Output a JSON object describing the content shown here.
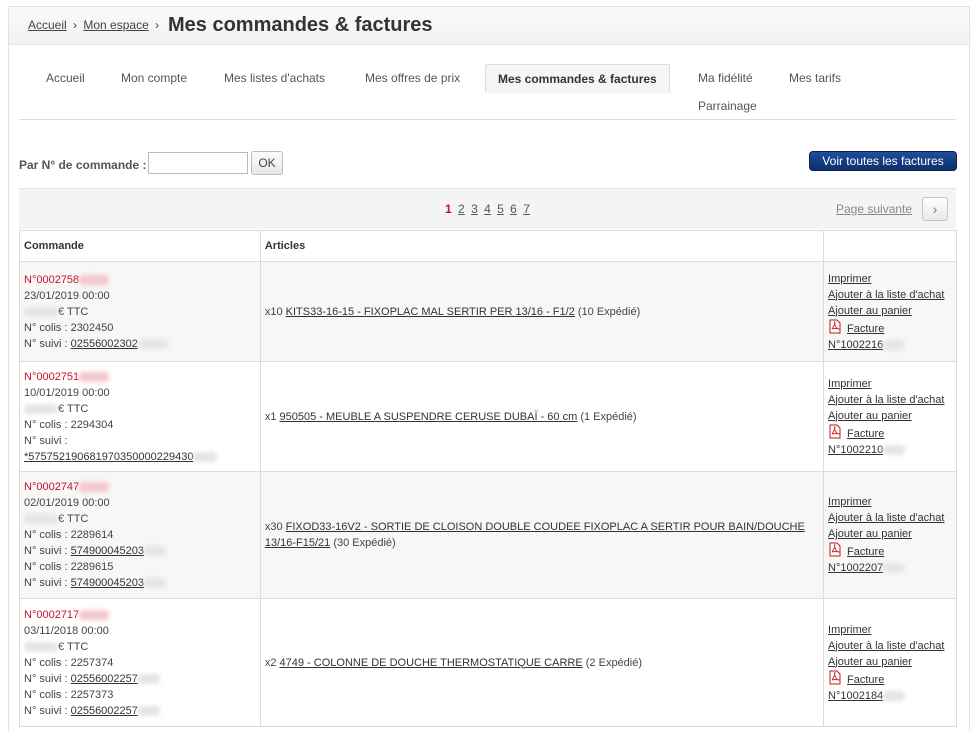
{
  "breadcrumb": {
    "home": "Accueil",
    "sep": "›",
    "space": "Mon espace",
    "sep2": "›"
  },
  "page_title": "Mes commandes & factures",
  "tabs": [
    {
      "label": "Accueil"
    },
    {
      "label": "Mon compte"
    },
    {
      "label": "Mes listes d'achats"
    },
    {
      "label": "Mes offres de prix"
    },
    {
      "label": "Mes commandes & factures",
      "active": true
    },
    {
      "label": "Ma fidélité"
    },
    {
      "label": "Mes tarifs"
    },
    {
      "label": "Parrainage"
    }
  ],
  "search": {
    "label": "Par N° de commande :",
    "value": "",
    "placeholder": "",
    "ok": "OK"
  },
  "all_invoices": "Voir toutes les factures",
  "pagination": {
    "pages": [
      "1",
      "2",
      "3",
      "4",
      "5",
      "6",
      "7"
    ],
    "current": "1",
    "next": "Page suivante",
    "next_icon": "chevron-right-icon"
  },
  "table": {
    "headers": [
      "Commande",
      "Articles",
      ""
    ],
    "rows": [
      {
        "order_number": "N°0002758",
        "date": "23/01/2019 00:00",
        "amount_suffix": "€ TTC",
        "parcels": [
          {
            "colis": "N° colis : 2302450",
            "suivi_label": "N° suivi :",
            "suivi_value": "02556002302"
          }
        ],
        "qty": "x10",
        "article": "KITS33-16-15 - FIXOPLAC MAL SERTIR PER 13/16 - F1/2",
        "status": "(10 Expédié)",
        "print": "Imprimer",
        "add_list": "Ajouter à la liste d'achat",
        "add_cart": "Ajouter au panier",
        "invoice_label": "Facture",
        "invoice_number": "N°1002216"
      },
      {
        "order_number": "N°0002751",
        "date": "10/01/2019 00:00",
        "amount_suffix": "€ TTC",
        "parcels": [
          {
            "colis": "N° colis : 2294304",
            "suivi_label": "N° suivi :",
            "suivi_value": "*575752190681970350000229430"
          }
        ],
        "qty": "x1",
        "article": "950505 - MEUBLE A SUSPENDRE CERUSE DUBAÏ - 60 cm",
        "status": "(1 Expédié)",
        "print": "Imprimer",
        "add_list": "Ajouter à la liste d'achat",
        "add_cart": "Ajouter au panier",
        "invoice_label": "Facture",
        "invoice_number": "N°1002210"
      },
      {
        "order_number": "N°0002747",
        "date": "02/01/2019 00:00",
        "amount_suffix": "€ TTC",
        "parcels": [
          {
            "colis": "N° colis : 2289614",
            "suivi_label": "N° suivi :",
            "suivi_value": "574900045203"
          },
          {
            "colis": "N° colis : 2289615",
            "suivi_label": "N° suivi :",
            "suivi_value": "574900045203"
          }
        ],
        "qty": "x30",
        "article": "FIXOD33-16V2 - SORTIE DE CLOISON DOUBLE COUDEE FIXOPLAC A SERTIR POUR BAIN/DOUCHE 13/16-F15/21",
        "status": "(30 Expédié)",
        "print": "Imprimer",
        "add_list": "Ajouter à la liste d'achat",
        "add_cart": "Ajouter au panier",
        "invoice_label": "Facture",
        "invoice_number": "N°1002207"
      },
      {
        "order_number": "N°0002717",
        "date": "03/11/2018 00:00",
        "amount_suffix": "€ TTC",
        "parcels": [
          {
            "colis": "N° colis : 2257374",
            "suivi_label": "N° suivi :",
            "suivi_value": "02556002257"
          },
          {
            "colis": "N° colis : 2257373",
            "suivi_label": "N° suivi :",
            "suivi_value": "02556002257"
          }
        ],
        "qty": "x2",
        "article": "4749 - COLONNE DE DOUCHE THERMOSTATIQUE CARRE",
        "status": "(2 Expédié)",
        "print": "Imprimer",
        "add_list": "Ajouter à la liste d'achat",
        "add_cart": "Ajouter au panier",
        "invoice_label": "Facture",
        "invoice_number": "N°1002184"
      }
    ]
  },
  "colors": {
    "accent_red": "#c8102e",
    "button_blue": "#0d2f6b"
  }
}
